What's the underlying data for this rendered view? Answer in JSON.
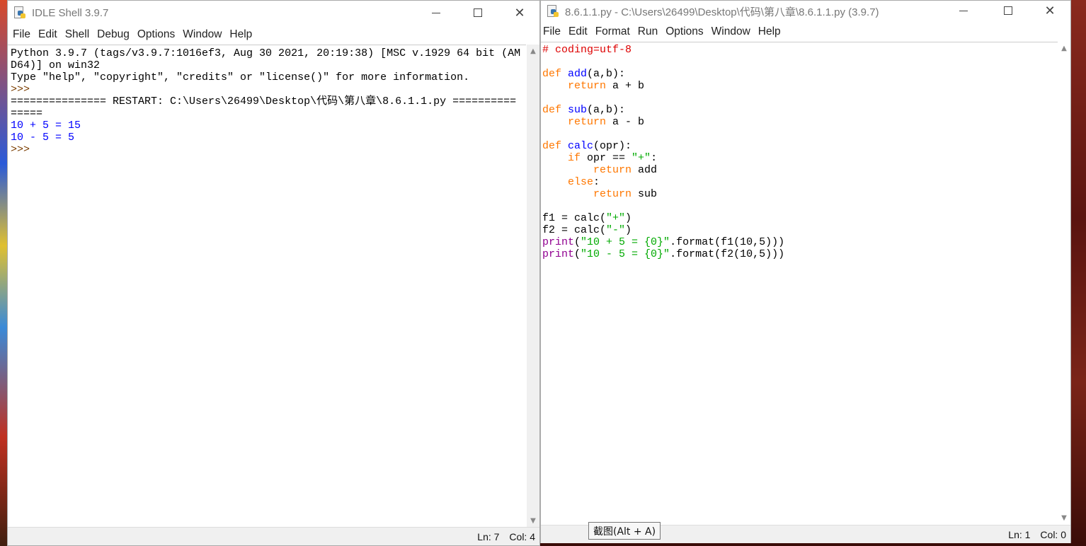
{
  "shell": {
    "title": "IDLE Shell 3.9.7",
    "menu": [
      "File",
      "Edit",
      "Shell",
      "Debug",
      "Options",
      "Window",
      "Help"
    ],
    "lines": [
      {
        "cls": "c-norm",
        "text": "Python 3.9.7 (tags/v3.9.7:1016ef3, Aug 30 2021, 20:19:38) [MSC v.1929 64 bit (AM"
      },
      {
        "cls": "c-norm",
        "text": "D64)] on win32"
      },
      {
        "cls": "c-norm",
        "text": "Type \"help\", \"copyright\", \"credits\" or \"license()\" for more information."
      },
      {
        "cls": "c-prompt",
        "text": ">>> "
      },
      {
        "cls": "c-norm",
        "text": "=============== RESTART: C:\\Users\\26499\\Desktop\\代码\\第八章\\8.6.1.1.py =========="
      },
      {
        "cls": "c-norm",
        "text": "====="
      },
      {
        "cls": "c-out",
        "text": "10 + 5 = 15"
      },
      {
        "cls": "c-out",
        "text": "10 - 5 = 5"
      },
      {
        "cls": "c-prompt",
        "text": ">>> "
      }
    ],
    "status": {
      "ln": "Ln: 7",
      "col": "Col: 4"
    }
  },
  "editor": {
    "title": "8.6.1.1.py - C:\\Users\\26499\\Desktop\\代码\\第八章\\8.6.1.1.py (3.9.7)",
    "menu": [
      "File",
      "Edit",
      "Format",
      "Run",
      "Options",
      "Window",
      "Help"
    ],
    "lines": [
      [
        {
          "c": "c-comment",
          "t": "# coding=utf-8"
        }
      ],
      [],
      [
        {
          "c": "c-kw",
          "t": "def "
        },
        {
          "c": "c-def",
          "t": "add"
        },
        {
          "c": "c-norm",
          "t": "(a,b):"
        }
      ],
      [
        {
          "c": "c-norm",
          "t": "    "
        },
        {
          "c": "c-kw",
          "t": "return"
        },
        {
          "c": "c-norm",
          "t": " a + b"
        }
      ],
      [],
      [
        {
          "c": "c-kw",
          "t": "def "
        },
        {
          "c": "c-def",
          "t": "sub"
        },
        {
          "c": "c-norm",
          "t": "(a,b):"
        }
      ],
      [
        {
          "c": "c-norm",
          "t": "    "
        },
        {
          "c": "c-kw",
          "t": "return"
        },
        {
          "c": "c-norm",
          "t": " a - b"
        }
      ],
      [],
      [
        {
          "c": "c-kw",
          "t": "def "
        },
        {
          "c": "c-def",
          "t": "calc"
        },
        {
          "c": "c-norm",
          "t": "(opr):"
        }
      ],
      [
        {
          "c": "c-norm",
          "t": "    "
        },
        {
          "c": "c-kw",
          "t": "if"
        },
        {
          "c": "c-norm",
          "t": " opr == "
        },
        {
          "c": "c-str",
          "t": "\"+\""
        },
        {
          "c": "c-norm",
          "t": ":"
        }
      ],
      [
        {
          "c": "c-norm",
          "t": "        "
        },
        {
          "c": "c-kw",
          "t": "return"
        },
        {
          "c": "c-norm",
          "t": " add"
        }
      ],
      [
        {
          "c": "c-norm",
          "t": "    "
        },
        {
          "c": "c-kw",
          "t": "else"
        },
        {
          "c": "c-norm",
          "t": ":"
        }
      ],
      [
        {
          "c": "c-norm",
          "t": "        "
        },
        {
          "c": "c-kw",
          "t": "return"
        },
        {
          "c": "c-norm",
          "t": " sub"
        }
      ],
      [],
      [
        {
          "c": "c-norm",
          "t": "f1 = calc("
        },
        {
          "c": "c-str",
          "t": "\"+\""
        },
        {
          "c": "c-norm",
          "t": ")"
        }
      ],
      [
        {
          "c": "c-norm",
          "t": "f2 = calc("
        },
        {
          "c": "c-str",
          "t": "\"-\""
        },
        {
          "c": "c-norm",
          "t": ")"
        }
      ],
      [
        {
          "c": "c-builtin",
          "t": "print"
        },
        {
          "c": "c-norm",
          "t": "("
        },
        {
          "c": "c-str",
          "t": "\"10 + 5 = {0}\""
        },
        {
          "c": "c-norm",
          "t": ".format(f1(10,5)))"
        }
      ],
      [
        {
          "c": "c-builtin",
          "t": "print"
        },
        {
          "c": "c-norm",
          "t": "("
        },
        {
          "c": "c-str",
          "t": "\"10 - 5 = {0}\""
        },
        {
          "c": "c-norm",
          "t": ".format(f2(10,5)))"
        }
      ]
    ],
    "status": {
      "ln": "Ln: 1",
      "col": "Col: 0"
    }
  },
  "tooltip": "截图(Alt + A)",
  "icons": {
    "minimize": "minimize-icon",
    "maximize": "maximize-icon",
    "close": "close-icon",
    "close_glyph": "✕",
    "scroll_up_glyph": "▲",
    "scroll_down_glyph": "▼"
  }
}
